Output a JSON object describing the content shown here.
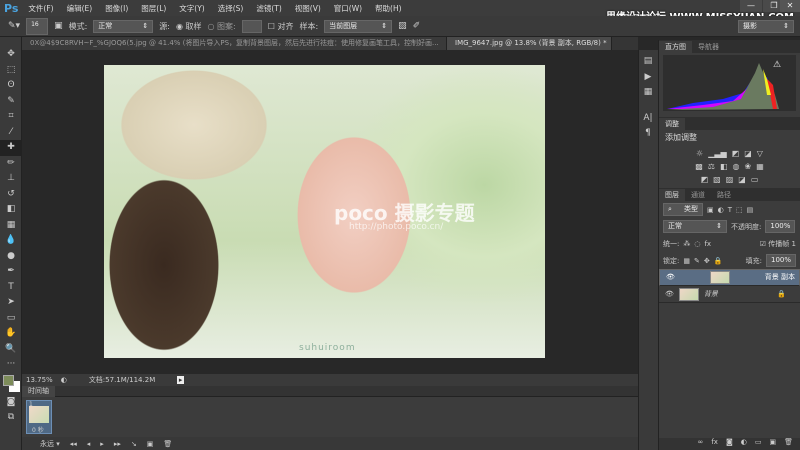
{
  "app": {
    "logo": "Ps",
    "watermark": "思缘设计论坛 WWW.MISSYUAN.COM"
  },
  "menu": [
    "文件(F)",
    "编辑(E)",
    "图像(I)",
    "图层(L)",
    "文字(Y)",
    "选择(S)",
    "滤镜(T)",
    "视图(V)",
    "窗口(W)",
    "帮助(H)"
  ],
  "window_buttons": [
    "—",
    "❐",
    "✕"
  ],
  "options": {
    "brush_size": "16",
    "mode_label": "模式:",
    "mode_value": "正常",
    "source_label": "源:",
    "sampled": "取样",
    "pattern": "图案:",
    "aligned": "对齐",
    "sample_label": "样本:",
    "sample_value": "当前图层",
    "workspace": "摄影"
  },
  "tabs": [
    {
      "label": "0X@4$9C8RVH~F_%GJOQ6(5.jpg @ 41.4% (将图片导入PS，复制背景图层，然后先进行祛痘：使用修复画笔工具，控制好画...",
      "close": "×"
    },
    {
      "label": "IMG_9647.jpg @ 13.8% (背景 副本, RGB/8) *",
      "close": "×"
    }
  ],
  "photo": {
    "watermark": "poco 摄影专题",
    "url": "http://photo.poco.cn/",
    "signature": "suhuiroom"
  },
  "status": {
    "zoom": "13.75%",
    "doc": "文档:57.1M/114.2M"
  },
  "timeline": {
    "title": "时间轴",
    "frame_number": "1",
    "frame_delay": "0 秒",
    "loop": "永远"
  },
  "histogram_panel": {
    "tabs": [
      "直方图",
      "导航器"
    ],
    "warning": "⚠"
  },
  "adjust_panel": {
    "tab": "调整",
    "title": "添加调整"
  },
  "layers_panel": {
    "tabs": [
      "图层",
      "通道",
      "路径"
    ],
    "filter": "类型",
    "blend": "正常",
    "opacity_label": "不透明度:",
    "opacity": "100%",
    "unify": "统一:",
    "propagate": "传播帧",
    "propagate_num": "1",
    "lock_label": "锁定:",
    "fill_label": "填充:",
    "fill": "100%",
    "layers": [
      {
        "name": "背景 副本",
        "selected": true
      },
      {
        "name": "背景",
        "selected": false,
        "locked": true
      }
    ]
  },
  "colors": {
    "foreground": "#7d8c5a",
    "background": "#ffffff",
    "accent": "#4aa3df"
  }
}
